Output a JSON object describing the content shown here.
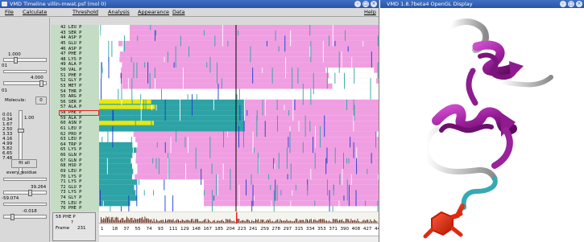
{
  "timeline_window": {
    "title": "VMD Timeline  villin-mwat.psf (mol 0)",
    "menus": [
      "File",
      "Calculate",
      "Threshold",
      "Analysis",
      "Appearance",
      "Data"
    ],
    "help": "Help",
    "controls": {
      "value1": "1.000",
      "value2": "01",
      "value3": "4.000",
      "value4": "01",
      "molecule_label": "Molecule:",
      "molecule_value": "0",
      "scale_value": "1.00",
      "scale_ticks": [
        "0.01",
        "0.34",
        "1.67",
        "2.50",
        "3.33",
        "4.16",
        "4.99",
        "5.82",
        "6.65",
        "7.48"
      ],
      "fit_all_label": "fit all",
      "every_residue_label": "every residue",
      "value5": "39.264",
      "value6": "-59.074",
      "value7": "-0.018"
    },
    "residue_labels": [
      "42 LEU P",
      "43 SER P",
      "44 ASP P",
      "45 GLU P",
      "46 ASP P",
      "47 PHE P",
      "48 LYS P",
      "49 ALA P",
      "50 VAL P",
      "51 PHE P",
      "52 GLY P",
      "53 MET P",
      "54 THR P",
      "55 ARG P",
      "56 SER P",
      "57 ALA P",
      "58 PHE P",
      "59 ALA P",
      "60 ASN P",
      "61 LEU P",
      "62 PRO P",
      "63 LEU P",
      "64 TRP P",
      "65 LYS P",
      "66 GLN P",
      "67 GLN P",
      "68 HSD P",
      "69 LEU P",
      "70 LYS P",
      "71 LYS P",
      "72 GLU P",
      "73 LYS P",
      "74 GLY P",
      "75 LEU P",
      "76 PHE P"
    ],
    "frame_info": {
      "line1": "58 PHE P",
      "line2": "?",
      "frame_label": "Frame",
      "frame_value": "231"
    },
    "axis_ticks": [
      "1",
      "18",
      "37",
      "55",
      "74",
      "93",
      "111",
      "129",
      "148",
      "167",
      "185",
      "204",
      "223",
      "241",
      "259",
      "278",
      "297",
      "315",
      "334",
      "353",
      "371",
      "390",
      "408",
      "427",
      "44"
    ],
    "colors": {
      "helix": "#f09ee2",
      "turn": "#2da3a6",
      "helix310": "#1b3ccf",
      "bridge": "#e8e80c",
      "coil": "#ffffff",
      "cursor": "#000000",
      "marker": "#ee2222"
    }
  },
  "gl_window": {
    "title": "VMD 1.8.7beta4 OpenGL Display"
  }
}
